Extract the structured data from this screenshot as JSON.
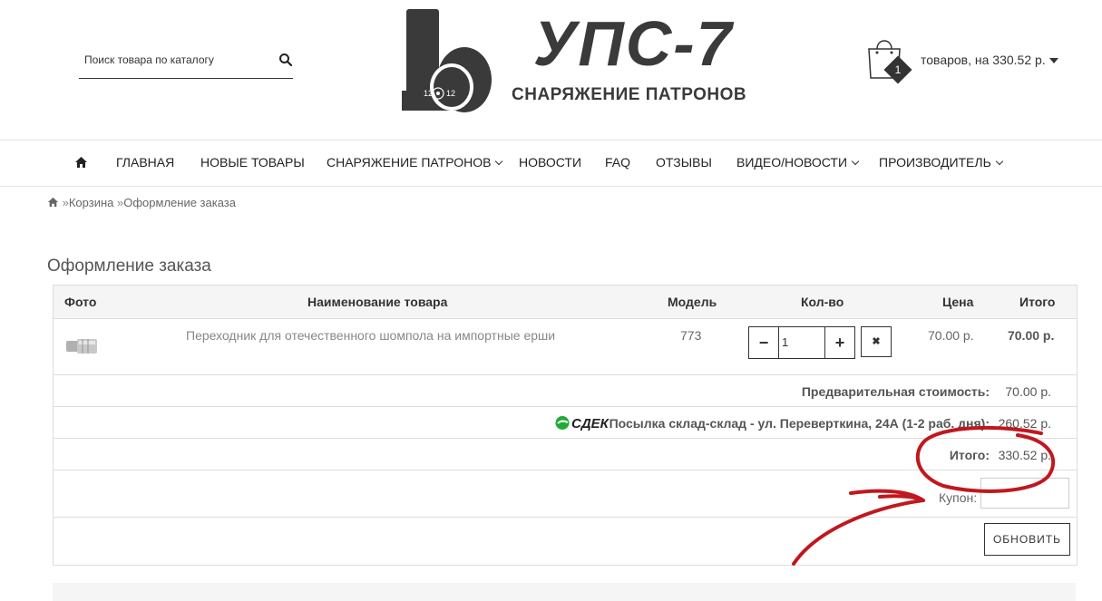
{
  "search": {
    "placeholder": "Поиск товара по каталогу"
  },
  "logo": {
    "title": "УПС-7",
    "subtitle": "СНАРЯЖЕНИЕ ПАТРОНОВ",
    "shell_label": "12"
  },
  "cart": {
    "count": "1",
    "summary": "товаров, на 330.52 р."
  },
  "nav": {
    "items": [
      {
        "label": "ГЛАВНАЯ"
      },
      {
        "label": "НОВЫЕ ТОВАРЫ"
      },
      {
        "label": "СНАРЯЖЕНИЕ ПАТРОНОВ"
      },
      {
        "label": "НОВОСТИ"
      },
      {
        "label": "FAQ"
      },
      {
        "label": "ОТЗЫВЫ"
      },
      {
        "label": "ВИДЕО/НОВОСТИ"
      },
      {
        "label": "ПРОИЗВОДИТЕЛЬ"
      }
    ]
  },
  "breadcrumb": {
    "sep": "»",
    "items": [
      "Корзина",
      "Оформление заказа"
    ]
  },
  "page": {
    "title": "Оформление заказа"
  },
  "table": {
    "headers": {
      "photo": "Фото",
      "name": "Наименование товара",
      "model": "Модель",
      "qty": "Кол-во",
      "price": "Цена",
      "total": "Итого"
    },
    "rows": [
      {
        "name": "Переходник для отечественного шомпола на импортные ерши",
        "model": "773",
        "qty": "1",
        "price": "70.00 р.",
        "total": "70.00 р."
      }
    ]
  },
  "totals": {
    "subtotal_label": "Предварительная стоимость:",
    "subtotal_value": "70.00 р.",
    "shipping_logo": "СДЕК",
    "shipping_label": "Посылка склад-склад - ул. Переверткина, 24А (1-2 раб. дня):",
    "shipping_value": "260.52 р.",
    "total_label": "Итого:",
    "total_value": "330.52 р."
  },
  "coupon": {
    "label": "Купон:",
    "value": ""
  },
  "update_button": "Обновить",
  "colors": {
    "annotation": "#c0181e",
    "text": "#333333",
    "header_bg": "#f5f5f5",
    "border": "#dddddd"
  },
  "icons": [
    "search-icon",
    "shopping-bag-icon",
    "home-icon",
    "chevron-down-icon",
    "minus-icon",
    "plus-icon",
    "remove-icon",
    "cdek-logo-icon"
  ]
}
